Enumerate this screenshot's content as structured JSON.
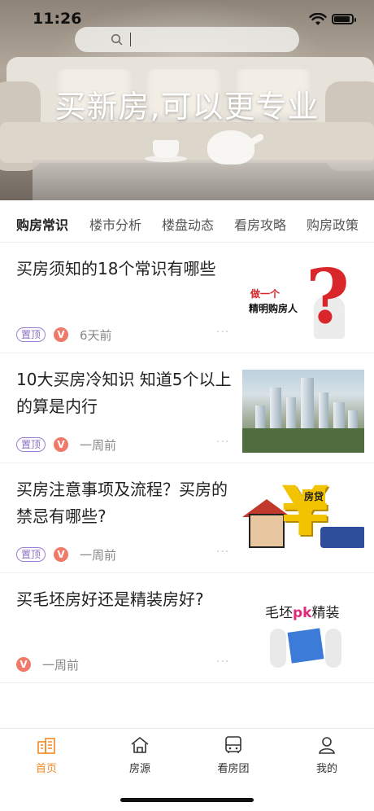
{
  "status_bar": {
    "time": "11:26"
  },
  "search": {
    "placeholder": ""
  },
  "hero": {
    "slogan": "买新房,可以更专业"
  },
  "tabs": [
    {
      "label": "购房常识",
      "active": true
    },
    {
      "label": "楼市分析",
      "active": false
    },
    {
      "label": "楼盘动态",
      "active": false
    },
    {
      "label": "看房攻略",
      "active": false
    },
    {
      "label": "购房政策",
      "active": false
    }
  ],
  "articles": [
    {
      "title": "买房须知的18个常识有哪些",
      "pinned_label": "置顶",
      "author_badge": "V",
      "time": "6天前",
      "more": "···",
      "thumb_text_1a": "做",
      "thumb_text_1b": "一个",
      "thumb_text_2": "精明购房人"
    },
    {
      "title": "10大买房冷知识 知道5个以上的算是内行",
      "pinned_label": "置顶",
      "author_badge": "V",
      "time": "一周前",
      "more": "···"
    },
    {
      "title": "买房注意事项及流程？买房的禁忌有哪些?",
      "pinned_label": "置顶",
      "author_badge": "V",
      "time": "一周前",
      "more": "···",
      "thumb_text": "房贷"
    },
    {
      "title": "买毛坯房好还是精装房好?",
      "author_badge": "V",
      "time": "一周前",
      "more": "···",
      "thumb_text_left": "毛坯",
      "thumb_text_pk": "pk",
      "thumb_text_right": "精装"
    }
  ],
  "bottom_nav": [
    {
      "label": "首页",
      "icon": "home-icon",
      "active": true
    },
    {
      "label": "房源",
      "icon": "house-source-icon",
      "active": false
    },
    {
      "label": "看房团",
      "icon": "bus-icon",
      "active": false
    },
    {
      "label": "我的",
      "icon": "user-icon",
      "active": false
    }
  ],
  "colors": {
    "accent": "#f08a24",
    "pin_badge": "#8a6fc4",
    "v_badge": "#f07a6a"
  }
}
